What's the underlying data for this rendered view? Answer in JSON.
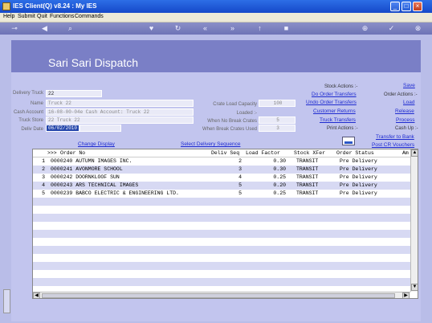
{
  "window": {
    "title": "IES Client(Q) v8.24 : My IES"
  },
  "menu": [
    "Help",
    "Submit",
    "Quit",
    "Functions",
    "Commands"
  ],
  "toolbar": {
    "icons": [
      "key-icon",
      "arrow-left-icon",
      "search-icon",
      "heart-icon",
      "refresh-icon",
      "rewind-icon",
      "fast-forward-icon",
      "up-icon",
      "stop-icon",
      "add-icon",
      "check-icon",
      "close-icon"
    ]
  },
  "banner": {
    "title": "Sari Sari Dispatch"
  },
  "form": {
    "delivery_truck_label": "Delivery Truck",
    "delivery_truck": "22",
    "name_label": "Name",
    "name": "Truck 22",
    "cash_account_label": "Cash Account",
    "cash_account": "16-08-00-04e Cash Account: Truck 22",
    "truck_store_label": "Truck Store",
    "truck_store": "22 Truck 22",
    "deliv_date_label": "Deliv Date",
    "deliv_date": "06/02/2010",
    "crate_load_capacity_label": "Crate Load Capacity",
    "crate_load_capacity": "100",
    "loaded_label": "Loaded :-",
    "when_no_break_crates_label": "When No Break Crates",
    "when_no_break_crates": "5",
    "when_break_crates_used_label": "When Break Crates Used",
    "when_break_crates_used": "3"
  },
  "actions": {
    "stock_actions": "Stock Actions :-",
    "do_order_transfers": "Do Order Transfers",
    "undo_order_transfers": "Undo Order Transfers",
    "customer_returns": "Customer Returns",
    "truck_transfers": "Truck Transfers",
    "print_actions": "Print Actions :-",
    "save": "Save",
    "order_actions": "Order Actions :-",
    "load": "Load",
    "release": "Release",
    "process": "Process",
    "cash_up": "Cash Up :-",
    "transfer_to_bank": "Transfer to Bank",
    "post_cr_vouchers": "Post CR Vouchers",
    "change_display": "Change Display",
    "select_delivery_sequence": "Select Delivery Sequence"
  },
  "grid": {
    "headers": {
      "marker": ">>>",
      "order_no": "Order No",
      "deliv_seq": "Deliv Seq",
      "load_factor": "Load Factor",
      "stock_xfer": "Stock XFer",
      "order_status": "Order Status",
      "am": "Am"
    },
    "rows": [
      {
        "n": "1",
        "order": "0000240 AUTUMN IMAGES INC.",
        "seq": "2",
        "lf": "0.30",
        "xfer": "TRANSIT",
        "status": "Pre Delivery"
      },
      {
        "n": "2",
        "order": "0000241 AVONMORE SCHOOL",
        "seq": "3",
        "lf": "0.30",
        "xfer": "TRANSIT",
        "status": "Pre Delivery"
      },
      {
        "n": "3",
        "order": "0000242 DOORNKLOOF SUN",
        "seq": "4",
        "lf": "0.25",
        "xfer": "TRANSIT",
        "status": "Pre Delivery"
      },
      {
        "n": "4",
        "order": "0000243 ARS TECHNICAL IMAGES",
        "seq": "5",
        "lf": "0.20",
        "xfer": "TRANSIT",
        "status": "Pre Delivery"
      },
      {
        "n": "5",
        "order": "0000239 BABCO ELECTRIC & ENGINEERING LTD.",
        "seq": "5",
        "lf": "0.25",
        "xfer": "TRANSIT",
        "status": "Pre Delivery"
      }
    ]
  },
  "colors": {
    "accent": "#7a7fc6",
    "link": "#1e2bd0",
    "title_bar": "#1548c9"
  }
}
